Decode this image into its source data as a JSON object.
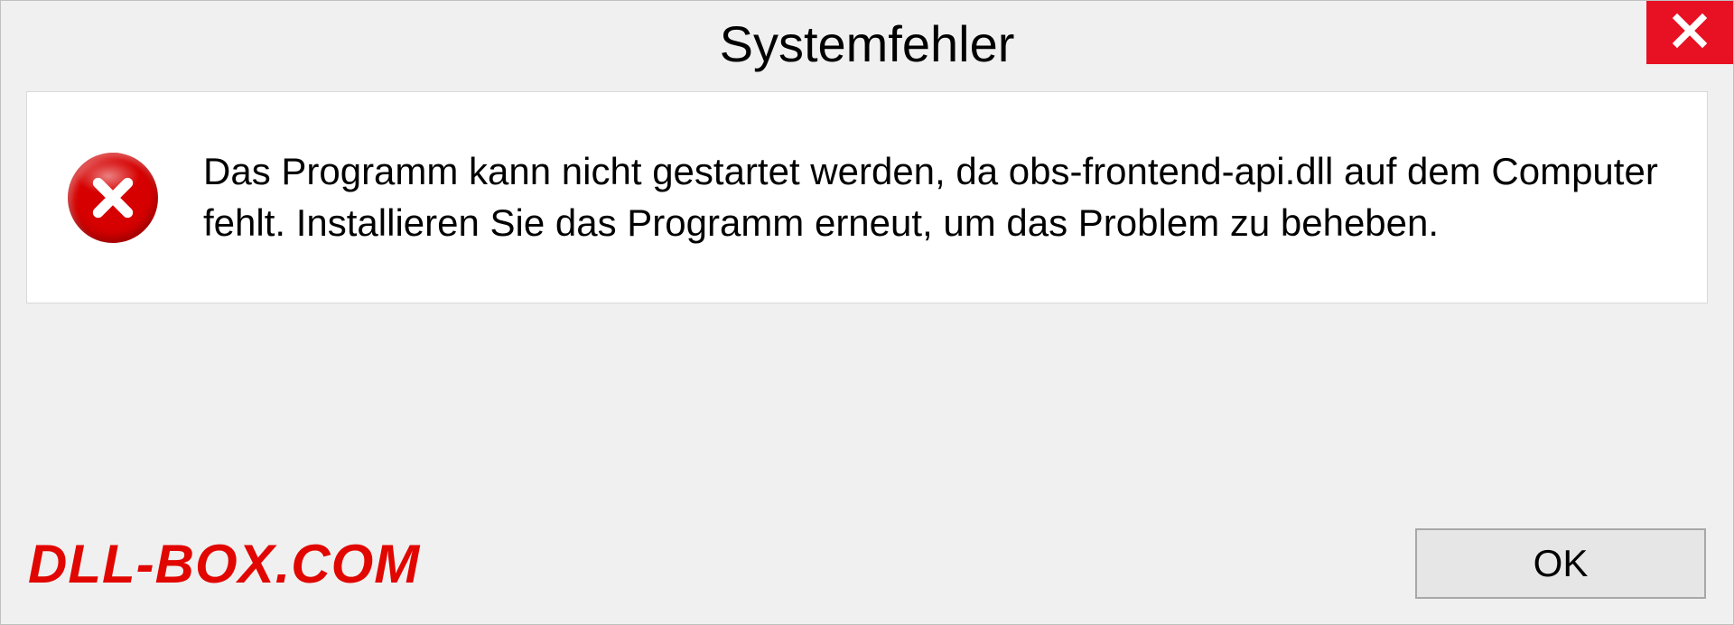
{
  "dialog": {
    "title": "Systemfehler",
    "message": "Das Programm kann nicht gestartet werden, da obs-frontend-api.dll auf dem Computer fehlt. Installieren Sie das Programm erneut, um das Problem zu beheben.",
    "ok_label": "OK"
  },
  "watermark": {
    "text": "DLL-BOX.COM"
  },
  "icons": {
    "close": "close-icon",
    "error": "error-icon"
  },
  "colors": {
    "close_bg": "#e81123",
    "error_bg": "#d60000",
    "watermark": "#e10600"
  }
}
